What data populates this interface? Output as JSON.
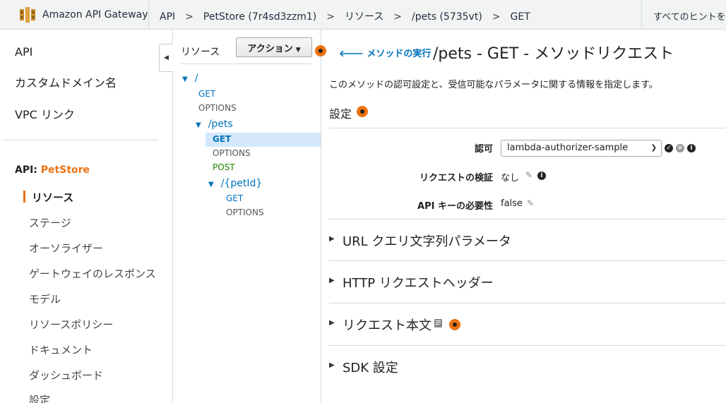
{
  "topbar": {
    "app_title": "Amazon API Gateway",
    "breadcrumb": [
      "API",
      "PetStore (7r4sd3zzm1)",
      "リソース",
      "/pets (5735vt)",
      "GET"
    ],
    "separator": ">",
    "hint": "すべてのヒントを"
  },
  "leftnav": {
    "top_items": [
      "API",
      "カスタムドメイン名",
      "VPC リンク"
    ],
    "api_prefix": "API: ",
    "api_name": "PetStore",
    "sub_items": [
      "リソース",
      "ステージ",
      "オーソライザー",
      "ゲートウェイのレスポンス",
      "モデル",
      "リソースポリシー",
      "ドキュメント",
      "ダッシュボード",
      "設定"
    ],
    "active_item": "リソース"
  },
  "tree": {
    "title": "リソース",
    "actions_label": "アクション",
    "nodes": {
      "root": "/",
      "root_get": "GET",
      "root_options": "OPTIONS",
      "pets": "/pets",
      "pets_get": "GET",
      "pets_options": "OPTIONS",
      "pets_post": "POST",
      "petid": "/{petId}",
      "petid_get": "GET",
      "petid_options": "OPTIONS"
    }
  },
  "main": {
    "back_link": "メソッドの実行",
    "title": "/pets - GET - メソッドリクエスト",
    "description": "このメソッドの認可設定と、受信可能なパラメータに関する情報を指定します。",
    "settings_title": "設定",
    "fields": {
      "auth_label": "認可",
      "auth_value": "lambda-authorizer-sample",
      "validation_label": "リクエストの検証",
      "validation_value": "なし",
      "apikey_label": "API キーの必要性",
      "apikey_value": "false"
    },
    "sections": [
      "URL クエリ文字列パラメータ",
      "HTTP リクエストヘッダー",
      "リクエスト本文",
      "SDK 設定"
    ]
  },
  "colors": {
    "accent": "#ec7211",
    "link": "#0073bb",
    "post": "#1d8102",
    "selected": "#d4e8f9"
  }
}
